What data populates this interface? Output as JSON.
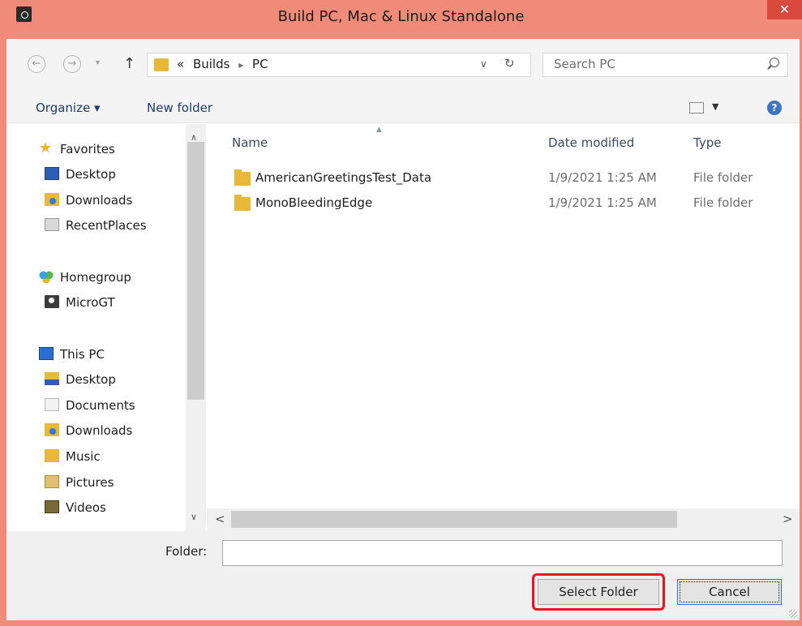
{
  "window": {
    "title": "Build PC, Mac & Linux Standalone",
    "close_glyph": "✕"
  },
  "nav": {
    "back_glyph": "←",
    "forward_glyph": "→",
    "recent_glyph": "▾",
    "up_glyph": "↑",
    "breadcrumb_prefix": "«",
    "breadcrumb": [
      "Builds",
      "PC"
    ],
    "breadcrumb_sep": "▸",
    "dropdown_glyph": "∨",
    "refresh_glyph": "↻",
    "search_placeholder": "Search PC"
  },
  "toolbar": {
    "organize_label": "Organize ▾",
    "new_folder_label": "New folder",
    "view_dd_glyph": "▼",
    "help_glyph": "?"
  },
  "navpane": {
    "favorites": {
      "label": "Favorites",
      "icon": "star-icon"
    },
    "favorites_items": [
      {
        "label": "Desktop",
        "icon": "desktop-icon"
      },
      {
        "label": "Downloads",
        "icon": "downloads-folder-icon"
      },
      {
        "label": "RecentPlaces",
        "icon": "recent-places-icon"
      }
    ],
    "homegroup": {
      "label": "Homegroup",
      "icon": "homegroup-icon"
    },
    "homegroup_items": [
      {
        "label": "MicroGT",
        "icon": "user-icon"
      }
    ],
    "thispc": {
      "label": "This PC",
      "icon": "computer-icon"
    },
    "thispc_items": [
      {
        "label": "Desktop",
        "icon": "desktop-folder-icon"
      },
      {
        "label": "Documents",
        "icon": "documents-icon"
      },
      {
        "label": "Downloads",
        "icon": "downloads-folder-icon"
      },
      {
        "label": "Music",
        "icon": "music-folder-icon"
      },
      {
        "label": "Pictures",
        "icon": "pictures-folder-icon"
      },
      {
        "label": "Videos",
        "icon": "videos-folder-icon"
      }
    ],
    "scroll_up_glyph": "∧",
    "scroll_down_glyph": "∨"
  },
  "filelist": {
    "columns": {
      "name": "Name",
      "date": "Date modified",
      "type": "Type",
      "sort_glyph": "▲"
    },
    "rows": [
      {
        "name": "AmericanGreetingsTest_Data",
        "date": "1/9/2021 1:25 AM",
        "type": "File folder"
      },
      {
        "name": "MonoBleedingEdge",
        "date": "1/9/2021 1:25 AM",
        "type": "File folder"
      }
    ],
    "hscroll_left_glyph": "<",
    "hscroll_right_glyph": ">"
  },
  "bottom": {
    "folder_label": "Folder:",
    "folder_value": "",
    "select_label": "Select Folder",
    "cancel_label": "Cancel"
  },
  "colors": {
    "title_bar": "#f08b7a",
    "close_button": "#d9493d",
    "highlight": "#e8141f"
  }
}
